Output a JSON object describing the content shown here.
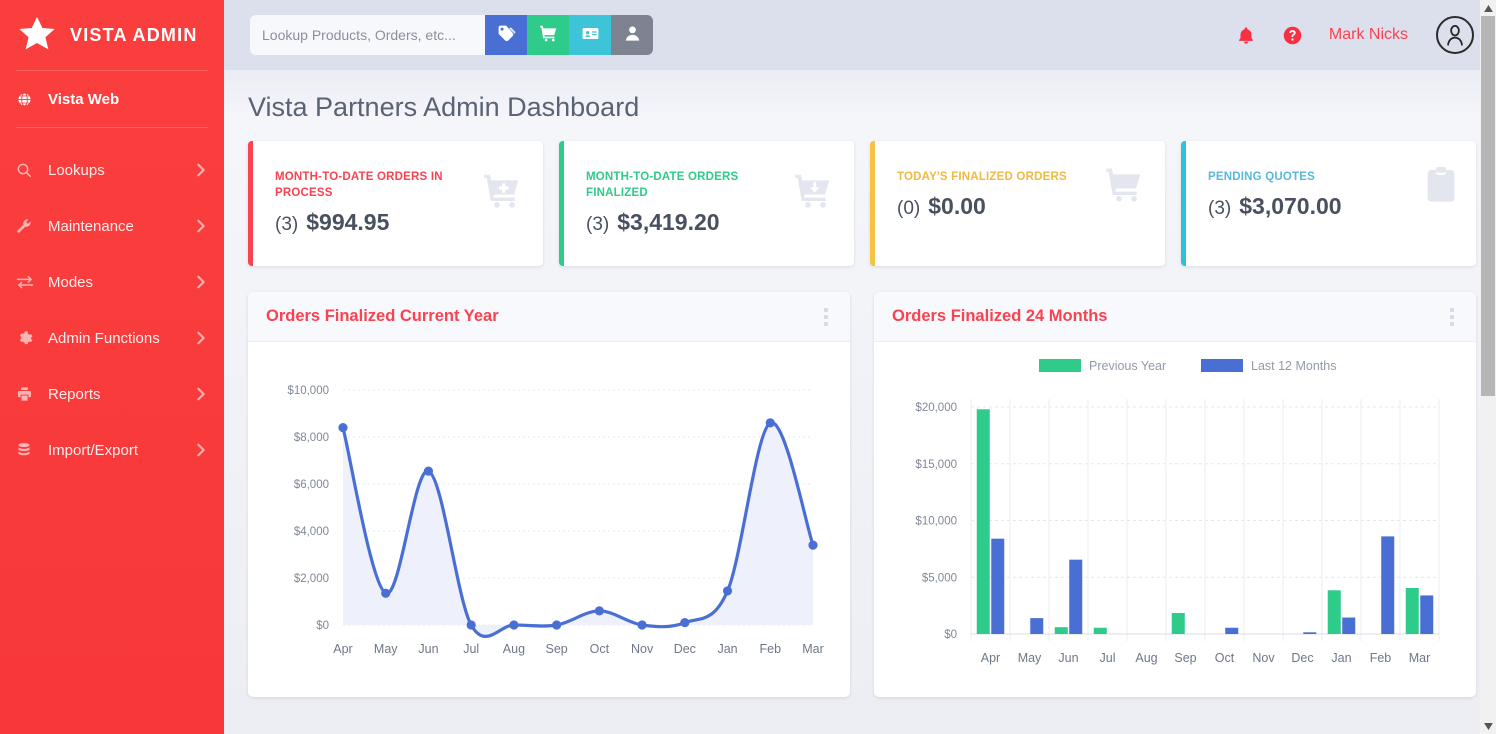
{
  "sidebar": {
    "brand": "VISTA ADMIN",
    "brand_icon": "star-icon",
    "active_item": {
      "label": "Vista Web",
      "icon": "globe-icon"
    },
    "items": [
      {
        "label": "Lookups",
        "icon": "search-icon"
      },
      {
        "label": "Maintenance",
        "icon": "wrench-icon"
      },
      {
        "label": "Modes",
        "icon": "exchange-icon"
      },
      {
        "label": "Admin Functions",
        "icon": "gear-icon"
      },
      {
        "label": "Reports",
        "icon": "printer-icon"
      },
      {
        "label": "Import/Export",
        "icon": "database-icon"
      }
    ]
  },
  "topbar": {
    "search_placeholder": "Lookup Products, Orders, etc...",
    "search_value": "",
    "buttons": [
      {
        "name": "tag-button",
        "icon": "tags-icon",
        "color": "#4a6fd4"
      },
      {
        "name": "cart-button",
        "icon": "cart-icon",
        "color": "#2ecb8a"
      },
      {
        "name": "card-button",
        "icon": "id-card-icon",
        "color": "#3ec4d8"
      },
      {
        "name": "user-button",
        "icon": "user-icon",
        "color": "#7d8391"
      }
    ],
    "notifications_icon": "bell-icon",
    "help_icon": "question-circle-icon",
    "user_name": "Mark Nicks",
    "avatar_icon": "user-avatar-icon"
  },
  "page": {
    "title": "Vista Partners Admin Dashboard"
  },
  "stats": [
    {
      "label": "MONTH-TO-DATE ORDERS IN PROCESS",
      "count": "(3)",
      "amount": "$994.95",
      "accent": "#fa4251",
      "icon": "cart-plus-icon"
    },
    {
      "label": "MONTH-TO-DATE ORDERS FINALIZED",
      "count": "(3)",
      "amount": "$3,419.20",
      "accent": "#2ecb8a",
      "icon": "cart-arrow-down-icon"
    },
    {
      "label": "TODAY'S FINALIZED ORDERS",
      "count": "(0)",
      "amount": "$0.00",
      "accent": "#f5c243",
      "icon": "cart-icon"
    },
    {
      "label": "PENDING QUOTES",
      "count": "(3)",
      "amount": "$3,070.00",
      "accent": "#2cc2d8",
      "icon": "clipboard-icon"
    }
  ],
  "panels": [
    {
      "title": "Orders Finalized Current Year",
      "menu_icon": "kebab-menu-icon"
    },
    {
      "title": "Orders Finalized 24 Months",
      "menu_icon": "kebab-menu-icon"
    }
  ],
  "chart_data": [
    {
      "type": "line",
      "title": "Orders Finalized Current Year",
      "xlabel": "",
      "ylabel": "",
      "categories": [
        "Apr",
        "May",
        "Jun",
        "Jul",
        "Aug",
        "Sep",
        "Oct",
        "Nov",
        "Dec",
        "Jan",
        "Feb",
        "Mar"
      ],
      "values": [
        8400,
        1350,
        6550,
        0,
        0,
        0,
        600,
        0,
        100,
        1450,
        8600,
        3400
      ],
      "ylim": [
        0,
        10000
      ],
      "yticks": [
        0,
        2000,
        4000,
        6000,
        8000,
        10000
      ],
      "ytick_labels": [
        "$0",
        "$2,000",
        "$4,000",
        "$6,000",
        "$8,000",
        "$10,000"
      ],
      "grid": true,
      "legend": "none",
      "line_color": "#4a6fd4",
      "fill_color": "#eef1fb",
      "smooth": true,
      "markers": true
    },
    {
      "type": "bar",
      "title": "Orders Finalized 24 Months",
      "xlabel": "",
      "ylabel": "",
      "categories": [
        "Apr",
        "May",
        "Jun",
        "Jul",
        "Aug",
        "Sep",
        "Oct",
        "Nov",
        "Dec",
        "Jan",
        "Feb",
        "Mar"
      ],
      "series": [
        {
          "name": "Previous Year",
          "color": "#2ecb8a",
          "values": [
            19800,
            0,
            600,
            550,
            0,
            1850,
            0,
            0,
            0,
            3850,
            0,
            4050
          ]
        },
        {
          "name": "Last 12 Months",
          "color": "#4a6fd4",
          "values": [
            8400,
            1400,
            6550,
            0,
            0,
            0,
            550,
            0,
            150,
            1450,
            8600,
            3400
          ]
        }
      ],
      "ylim": [
        0,
        20000
      ],
      "yticks": [
        0,
        5000,
        10000,
        15000,
        20000
      ],
      "ytick_labels": [
        "$0",
        "$5,000",
        "$10,000",
        "$15,000",
        "$20,000"
      ],
      "grid": true,
      "legend": "top"
    }
  ]
}
